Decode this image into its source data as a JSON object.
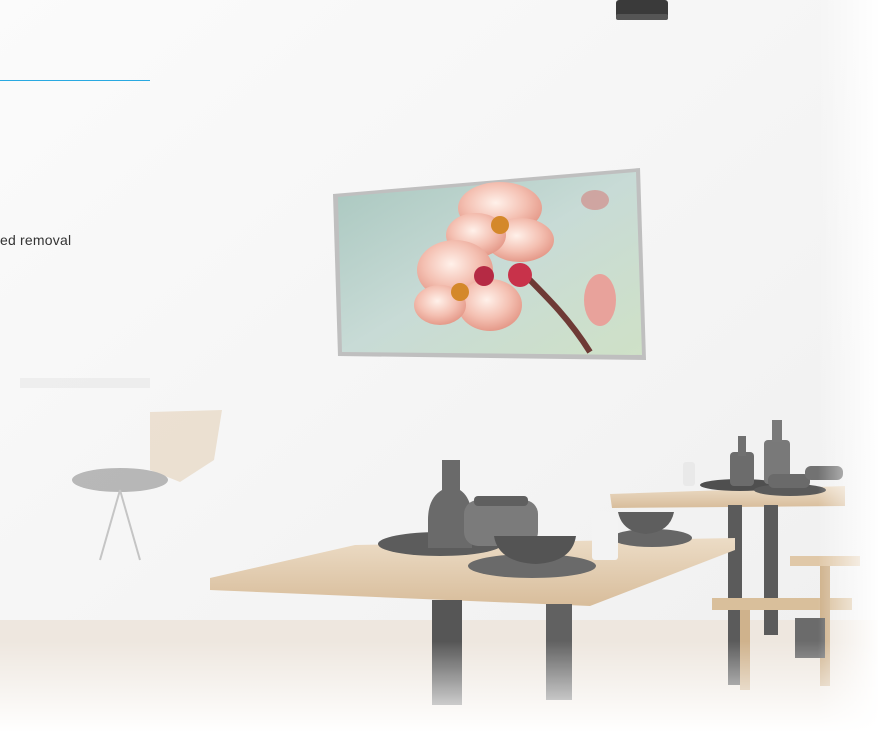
{
  "hero": {
    "feature_text": "ed removal"
  },
  "colors": {
    "accent": "#29a9e1",
    "wall": "#f6f6f6",
    "wood": "#dcc4a6",
    "metal": "#6b6b6b"
  },
  "icons": {
    "ceiling_device": "mounted-device-icon"
  }
}
